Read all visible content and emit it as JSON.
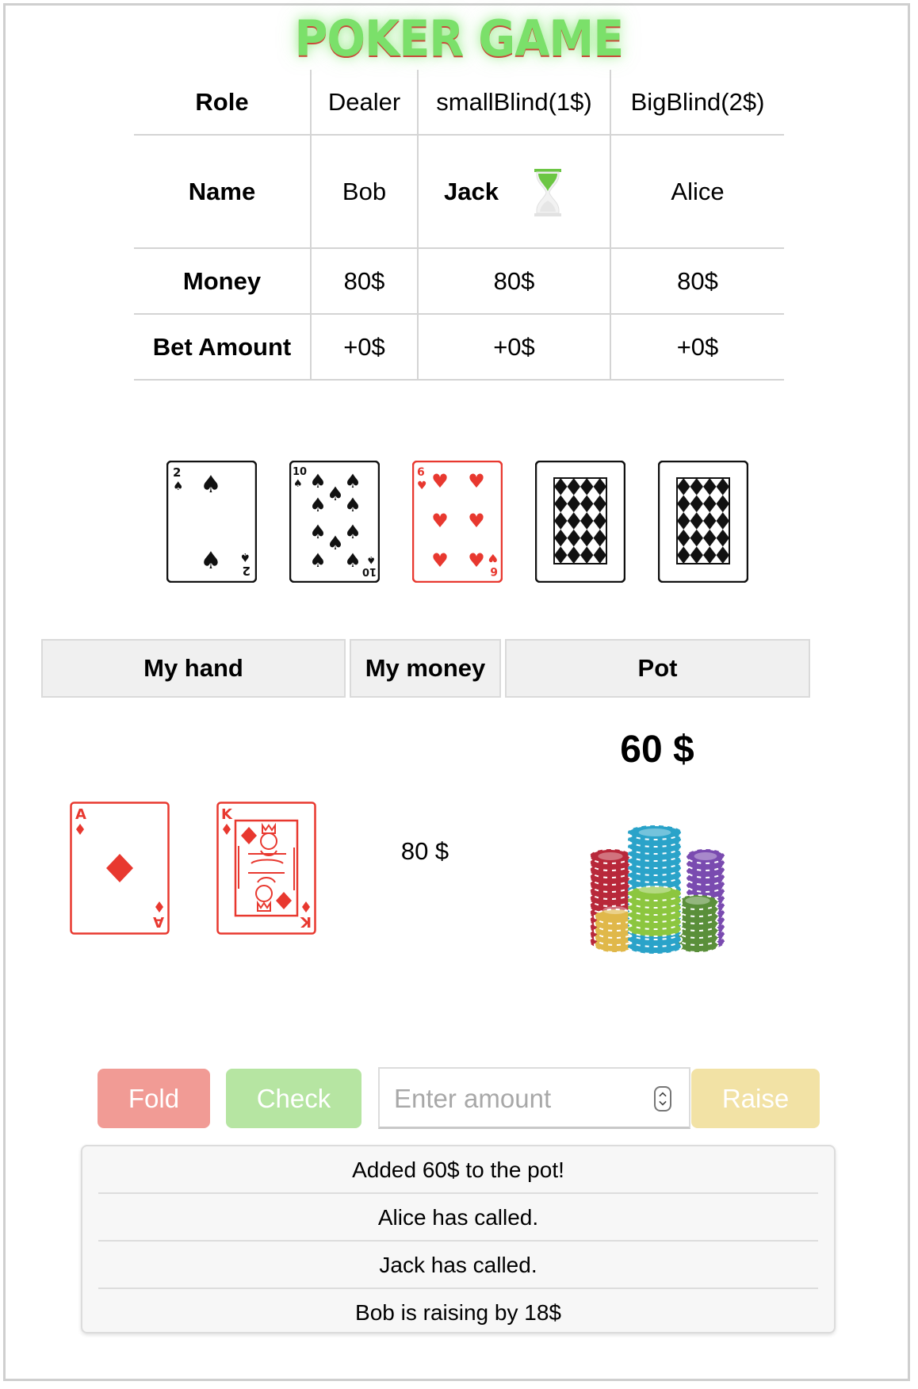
{
  "title": "POKER GAME",
  "players_table": {
    "role_header": "Role",
    "name_header": "Name",
    "money_header": "Money",
    "bet_header": "Bet Amount",
    "players": [
      {
        "role": "Dealer",
        "name": "Bob",
        "money": "80$",
        "bet": "+0$",
        "active": false
      },
      {
        "role": "smallBlind(1$)",
        "name": "Jack",
        "money": "80$",
        "bet": "+0$",
        "active": true
      },
      {
        "role": "BigBlind(2$)",
        "name": "Alice",
        "money": "80$",
        "bet": "+0$",
        "active": false
      }
    ]
  },
  "community_cards": [
    {
      "rank": "2",
      "suit": "spades",
      "face_up": true
    },
    {
      "rank": "10",
      "suit": "spades",
      "face_up": true
    },
    {
      "rank": "6",
      "suit": "hearts",
      "face_up": true
    },
    {
      "face_up": false
    },
    {
      "face_up": false
    }
  ],
  "info_headers": {
    "hand": "My hand",
    "money": "My money",
    "pot": "Pot"
  },
  "my_hand": [
    {
      "rank": "A",
      "suit": "diamonds"
    },
    {
      "rank": "K",
      "suit": "diamonds"
    }
  ],
  "my_money": "80 $",
  "pot": "60 $",
  "icons": {
    "turn_indicator": "hourglass-icon",
    "pot_image": "poker-chips-icon"
  },
  "actions": {
    "fold_label": "Fold",
    "check_label": "Check",
    "amount_placeholder": "Enter amount",
    "raise_label": "Raise"
  },
  "colors": {
    "title": "#7be06a",
    "fold": "#f19b95",
    "check": "#b6e5a2",
    "raise": "#f2e2a5",
    "red_suit": "#e8382f",
    "hourglass": "#6cc644"
  },
  "log": [
    "Added 60$ to the pot!",
    "Alice has called.",
    "Jack has called.",
    "Bob is raising by 18$"
  ]
}
